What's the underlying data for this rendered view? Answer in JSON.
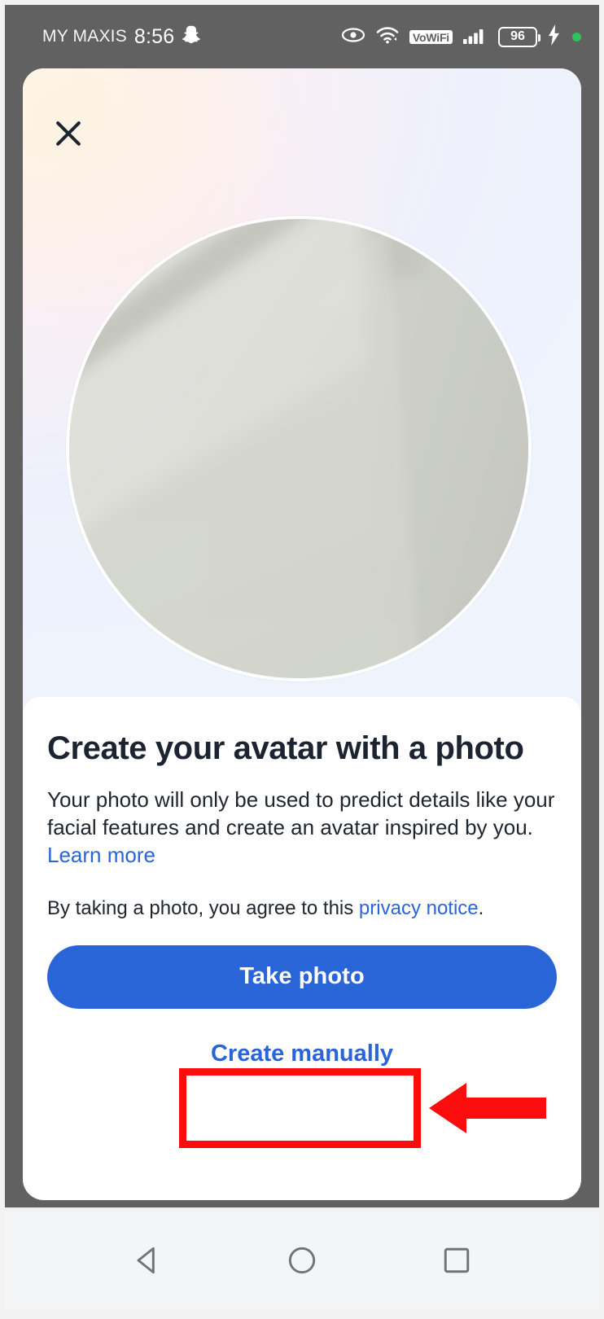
{
  "status_bar": {
    "carrier": "MY MAXIS",
    "time": "8:56",
    "snapchat_icon": "snapchat-ghost-icon",
    "eye_icon": "eye-icon",
    "wifi_icon": "wifi-icon",
    "vowifi_label": "VoWiFi",
    "signal_icon": "cellular-signal-icon",
    "battery_level": "96",
    "charging_icon": "lightning-bolt-icon",
    "recording_dot": "green-status-dot"
  },
  "screen": {
    "close_icon": "close-x-icon",
    "camera_preview": "circular-camera-preview"
  },
  "sheet": {
    "title": "Create your avatar with a photo",
    "body_text_1": "Your photo will only be used to predict details like your facial features and create an avatar inspired by you. ",
    "learn_more_link": "Learn more",
    "legal_prefix": "By taking a photo, you agree to this ",
    "privacy_link": "privacy notice",
    "legal_suffix": ".",
    "primary_button": "Take photo",
    "secondary_button": "Create manually"
  },
  "annotations": {
    "highlight_box": "red-highlight-rectangle",
    "pointer_arrow": "red-left-arrow"
  },
  "nav_bar": {
    "back": "back-triangle-icon",
    "home": "home-circle-icon",
    "recents": "recents-square-icon"
  },
  "colors": {
    "accent_blue": "#2a65d8",
    "link_blue": "#2a65d8",
    "annotation_red": "#fc0d0d",
    "bezel_gray": "#616161",
    "title_dark": "#1b2430",
    "status_green": "#2fc25b"
  }
}
